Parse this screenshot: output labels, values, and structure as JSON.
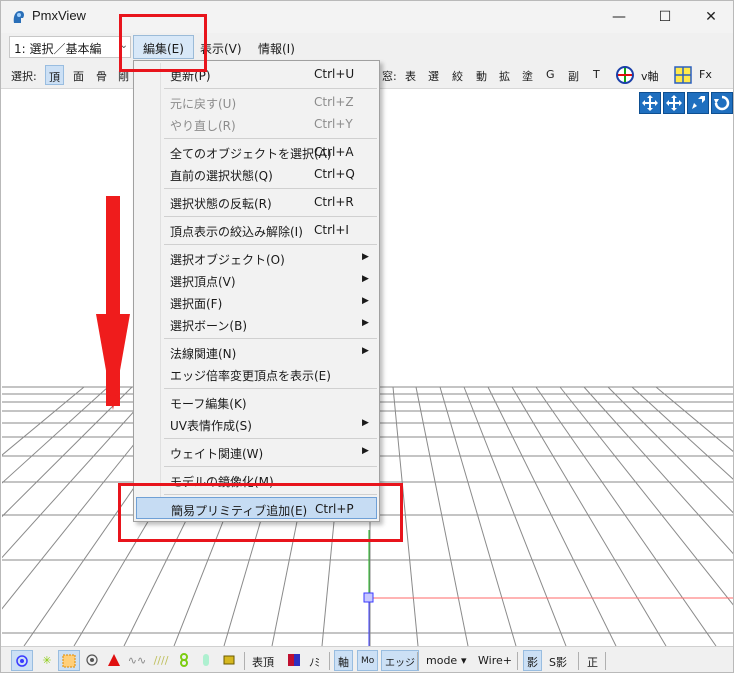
{
  "window": {
    "title": "PmxView",
    "controls": {
      "minimize": "—",
      "maximize": "☐",
      "close": "✕"
    }
  },
  "menubar": {
    "mode_select": {
      "value": "1: 選択／基本編"
    },
    "menus": [
      {
        "label": "編集(E)"
      },
      {
        "label": "表示(V)"
      },
      {
        "label": "情報(I)"
      }
    ]
  },
  "toolbar": {
    "select_label": "選択:",
    "left_items": [
      "頂",
      "面",
      "骨",
      "剛"
    ],
    "right_label": "窓:",
    "right_items": [
      "表",
      "選",
      "絞",
      "動",
      "拡",
      "塗",
      "G",
      "副",
      "T"
    ],
    "axis_label": "v軸",
    "fx_label": "Fx"
  },
  "dropdown": {
    "items": [
      {
        "label": "更新(P)",
        "shortcut": "Ctrl+U"
      },
      {
        "label": "元に戻す(U)",
        "shortcut": "Ctrl+Z",
        "disabled": true
      },
      {
        "label": "やり直し(R)",
        "shortcut": "Ctrl+Y",
        "disabled": true
      },
      {
        "label": "全てのオブジェクトを選択(A)",
        "shortcut": "Ctrl+A"
      },
      {
        "label": "直前の選択状態(Q)",
        "shortcut": "Ctrl+Q"
      },
      {
        "label": "選択状態の反転(R)",
        "shortcut": "Ctrl+R"
      },
      {
        "label": "頂点表示の絞込み解除(I)",
        "shortcut": "Ctrl+I"
      },
      {
        "label": "選択オブジェクト(O)",
        "submenu": true
      },
      {
        "label": "選択頂点(V)",
        "submenu": true
      },
      {
        "label": "選択面(F)",
        "submenu": true
      },
      {
        "label": "選択ボーン(B)",
        "submenu": true
      },
      {
        "label": "法線関連(N)",
        "submenu": true
      },
      {
        "label": "エッジ倍率変更頂点を表示(E)"
      },
      {
        "label": "モーフ編集(K)"
      },
      {
        "label": "UV表情作成(S)",
        "submenu": true
      },
      {
        "label": "ウェイト関連(W)",
        "submenu": true
      },
      {
        "label": "モデルの鏡像化(M)"
      },
      {
        "label": "簡易プリミティブ追加(E)",
        "shortcut": "Ctrl+P",
        "highlighted": true
      }
    ],
    "submenu_glyph": "▶"
  },
  "statusbar": {
    "vertex_label": "表頂",
    "mirror_label": "ﾉﾐ",
    "axis_label": "軸",
    "mo_label": "Mo",
    "edge_label": "エッジ",
    "mode_label": "mode",
    "mode_arrow": "▾",
    "wire_label": "Wire+",
    "shadow_label": "影",
    "sshadow_label": "S影",
    "front_label": "正"
  },
  "colors": {
    "accent_red": "#e8141c",
    "highlight": "#c6dcf3",
    "view_button_blue": "#1f6fbf"
  }
}
